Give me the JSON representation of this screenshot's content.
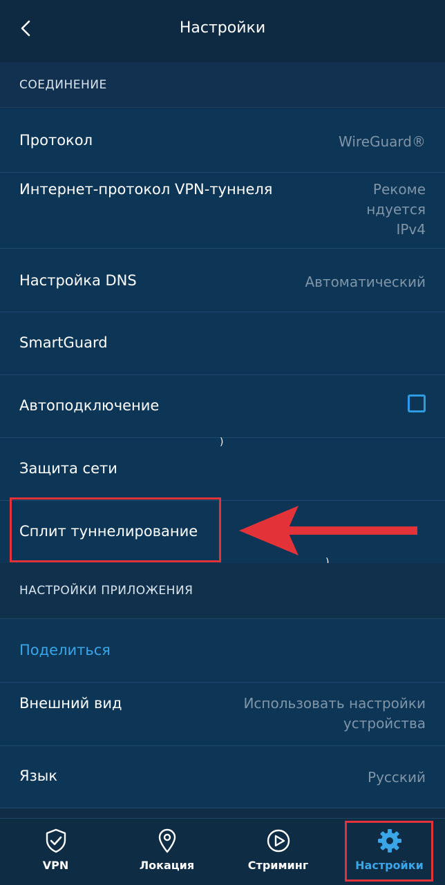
{
  "header": {
    "title": "Настройки",
    "back_icon": "chevron-left-icon"
  },
  "sections": {
    "connection": "СОЕДИНЕНИЕ",
    "app_settings": "НАСТРОЙКИ ПРИЛОЖЕНИЯ"
  },
  "rows": {
    "protocol": {
      "label": "Протокол",
      "value": "WireGuard®"
    },
    "tunnel_ip": {
      "label": "Интернет-протокол VPN-туннеля",
      "value_lines": [
        "Рекоме",
        "ндуется",
        "IPv4"
      ]
    },
    "dns": {
      "label": "Настройка DNS",
      "value": "Автоматический"
    },
    "smartguard": {
      "label": "SmartGuard"
    },
    "autoconnect": {
      "label": "Автоподключение",
      "checked": false
    },
    "network_protection": {
      "label": "Защита сети"
    },
    "split_tunneling": {
      "label": "Сплит туннелирование"
    },
    "share": {
      "label": "Поделиться"
    },
    "appearance": {
      "label": "Внешний вид",
      "value_lines": [
        "Использовать настройки",
        "устройства"
      ]
    },
    "language": {
      "label": "Язык",
      "value": "Русский"
    }
  },
  "stray_marks": [
    ")",
    ")"
  ],
  "bottom_nav": [
    {
      "label": "VPN",
      "icon": "shield-check-icon"
    },
    {
      "label": "Локация",
      "icon": "location-pin-icon"
    },
    {
      "label": "Стриминг",
      "icon": "play-circle-icon"
    },
    {
      "label": "Настройки",
      "icon": "gear-icon"
    }
  ],
  "colors": {
    "background": "#102c46",
    "row": "#0d3556",
    "accent": "#3aa6e8",
    "highlight": "#e33339",
    "muted": "#8095a8"
  }
}
